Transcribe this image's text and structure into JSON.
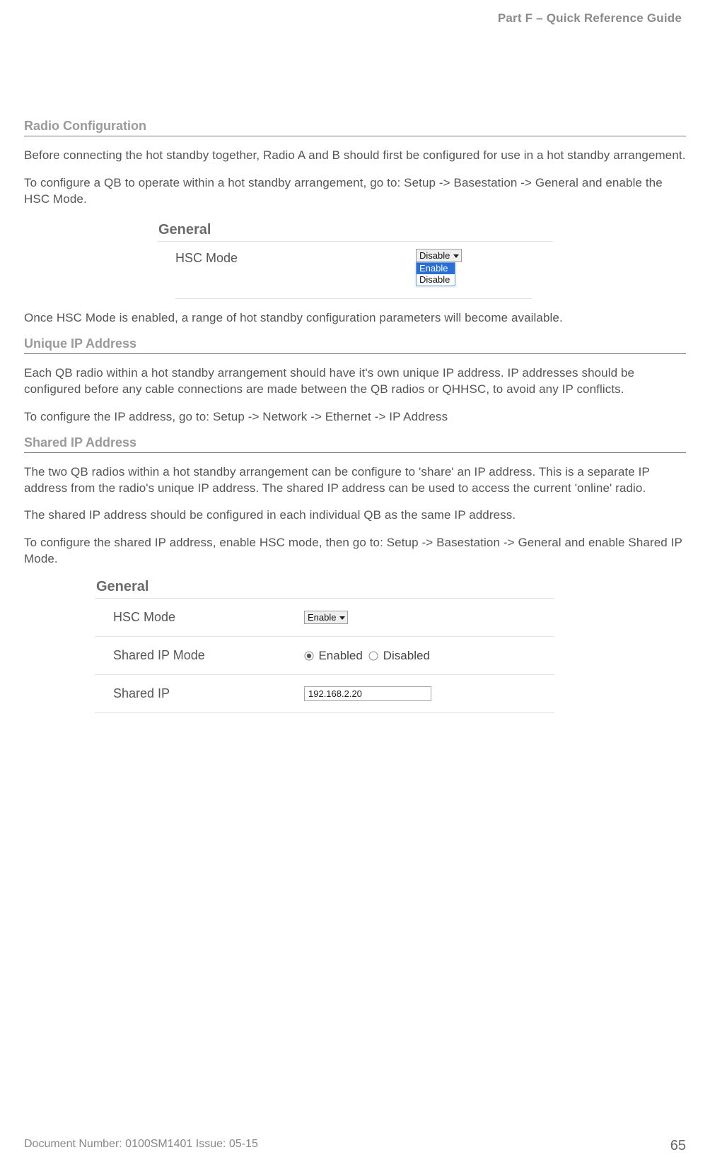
{
  "header": {
    "part": "Part F – Quick Reference Guide"
  },
  "sections": {
    "radio_config": {
      "title": "Radio Configuration",
      "p1": "Before connecting the hot standby together, Radio A and B should first be configured for use in a hot standby arrangement.",
      "p2": "To configure a QB to operate within a hot standby arrangement, go to: Setup -> Basestation -> General and enable the HSC Mode.",
      "after": "Once HSC Mode is enabled, a range of hot standby configuration parameters will become available."
    },
    "unique_ip": {
      "title": "Unique IP Address",
      "p1": "Each QB radio within a hot standby arrangement should have it's own unique IP address. IP addresses should be configured before any cable connections are made between the QB radios or QHHSC, to avoid any IP conflicts.",
      "p2": "To configure the IP address, go to: Setup -> Network -> Ethernet -> IP Address"
    },
    "shared_ip": {
      "title": "Shared IP Address",
      "p1": "The two QB radios within a hot standby arrangement can be configure to 'share' an IP address. This is a separate IP address from the radio's unique IP address. The shared IP address can be used to access the current 'online' radio.",
      "p2": "The shared IP address should be configured in each individual QB as the same IP address.",
      "p3": "To configure the shared IP address, enable HSC mode, then go to: Setup -> Basestation -> General and enable Shared IP Mode."
    }
  },
  "panel1": {
    "title": "General",
    "hsc_label": "HSC Mode",
    "select_value": "Disable",
    "options": [
      "Enable",
      "Disable"
    ]
  },
  "panel2": {
    "title": "General",
    "hsc_label": "HSC Mode",
    "hsc_value": "Enable",
    "sharedmode_label": "Shared IP Mode",
    "enabled_label": "Enabled",
    "disabled_label": "Disabled",
    "sharedip_label": "Shared IP",
    "sharedip_value": "192.168.2.20"
  },
  "footer": {
    "left": "Document Number: 0100SM1401   Issue: 05-15",
    "page": "65"
  }
}
